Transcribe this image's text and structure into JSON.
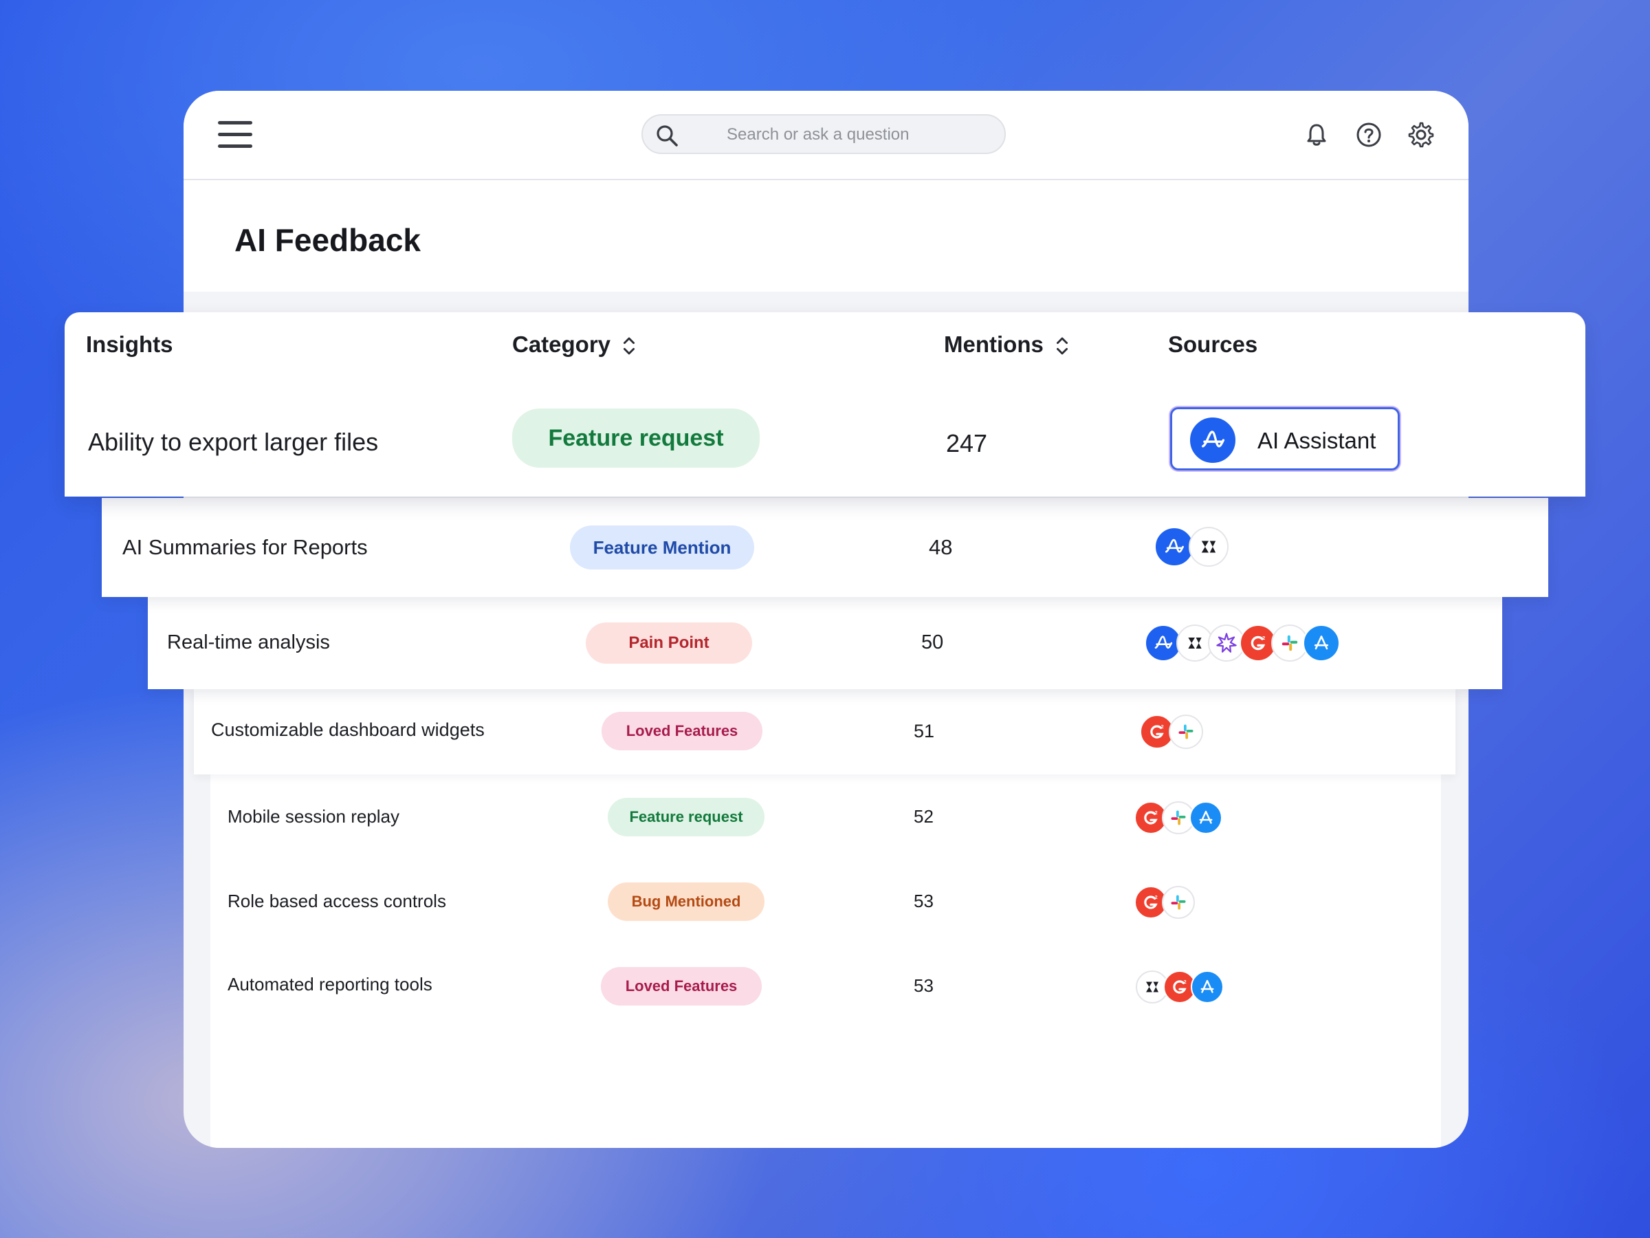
{
  "search": {
    "placeholder": "Search or ask a question"
  },
  "page": {
    "title": "AI Feedback"
  },
  "table": {
    "headers": {
      "insights": "Insights",
      "category": "Category",
      "mentions": "Mentions",
      "sources": "Sources"
    },
    "rows": [
      {
        "insight": "Ability to export larger files",
        "category": "Feature request",
        "category_color": "#dff3e6",
        "mentions": "247",
        "sources": [
          "amplitude-icon"
        ],
        "source_label": "AI Assistant"
      },
      {
        "insight": "AI Summaries for Reports",
        "category": "Feature Mention",
        "category_color": "#dbe8fd",
        "mentions": "48",
        "sources": [
          "amplitude-icon",
          "zendesk-icon"
        ]
      },
      {
        "insight": "Real-time analysis",
        "category": "Pain Point",
        "category_color": "#fde1df",
        "mentions": "50",
        "sources": [
          "amplitude-icon",
          "zendesk-icon",
          "spark-icon",
          "g2-icon",
          "slack-icon",
          "app-store-icon"
        ]
      },
      {
        "insight": "Customizable dashboard widgets",
        "category": "Loved Features",
        "category_color": "#fadbe6",
        "mentions": "51",
        "sources": [
          "g2-icon",
          "slack-icon"
        ]
      },
      {
        "insight": "Mobile session replay",
        "category": "Feature request",
        "category_color": "#dff3e6",
        "mentions": "52",
        "sources": [
          "g2-icon",
          "slack-icon",
          "app-store-icon"
        ]
      },
      {
        "insight": "Role based access controls",
        "category": "Bug Mentioned",
        "category_color": "#fde0cc",
        "mentions": "53",
        "sources": [
          "g2-icon",
          "slack-icon"
        ]
      },
      {
        "insight": "Automated reporting tools",
        "category": "Loved Features",
        "category_color": "#fadbe6",
        "mentions": "53",
        "sources": [
          "zendesk-icon",
          "g2-icon",
          "app-store-icon"
        ]
      }
    ]
  },
  "colors": {
    "accent": "#1e61f0",
    "g2": "#ef3f2e",
    "app_store": "#1a8cf5"
  }
}
